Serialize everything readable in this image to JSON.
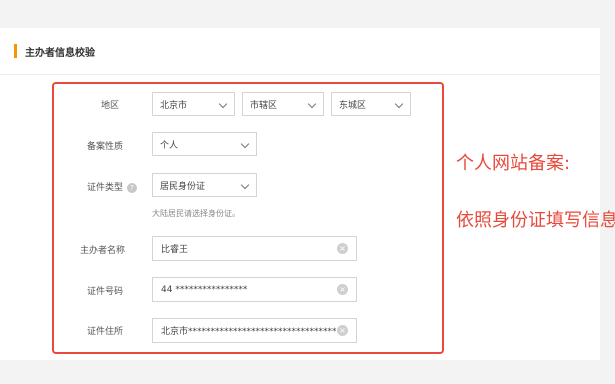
{
  "section": {
    "title": "主办者信息校验"
  },
  "form": {
    "region_label": "地区",
    "region_province": "北京市",
    "region_city": "市辖区",
    "region_district": "东城区",
    "nature_label": "备案性质",
    "nature_value": "个人",
    "id_type_label": "证件类型",
    "id_type_value": "居民身份证",
    "id_type_hint": "大陆居民请选择身份证。",
    "sponsor_name_label": "主办者名称",
    "sponsor_name_value": "比睿王",
    "id_number_label": "证件号码",
    "id_number_value": "44 ****************",
    "id_address_label": "证件住所",
    "id_address_value": "北京市**************************************"
  },
  "annotation": {
    "line1": "个人网站备案:",
    "line2": "依照身份证填写信息"
  },
  "colors": {
    "accent": "#f39800",
    "highlight": "#e74a3b"
  }
}
